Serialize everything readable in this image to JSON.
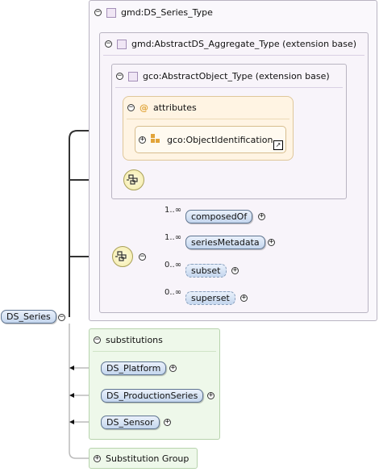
{
  "series_type": {
    "label": "gmd:DS_Series_Type"
  },
  "aggregate_type": {
    "label": "gmd:AbstractDS_Aggregate_Type (extension base)"
  },
  "object_type": {
    "label": "gco:AbstractObject_Type (extension base)"
  },
  "attributes": {
    "label": "attributes",
    "at_symbol": "@",
    "item": "gco:ObjectIdentification"
  },
  "root": {
    "label": "DS_Series"
  },
  "sequence_children": [
    {
      "label": "composedOf",
      "card": "1..∞"
    },
    {
      "label": "seriesMetadata",
      "card": "1..∞"
    },
    {
      "label": "subset",
      "card": "0..∞"
    },
    {
      "label": "superset",
      "card": "0..∞"
    }
  ],
  "substitutions": {
    "label": "substitutions",
    "items": [
      "DS_Platform",
      "DS_ProductionSeries",
      "DS_Sensor"
    ]
  },
  "substitution_group": {
    "label": "Substitution Group"
  },
  "colors": {
    "frame_border": "#b9b4c2",
    "type_fill": "#f8f4fa",
    "attr_fill": "#fff4e3",
    "attr_border": "#dfc79a",
    "subs_fill": "#eef8ea",
    "subs_border": "#b7d3ad",
    "pill_top": "#eaf1fb",
    "pill_bottom": "#c4d6ee",
    "compositor_fill": "#f3e9a6"
  }
}
